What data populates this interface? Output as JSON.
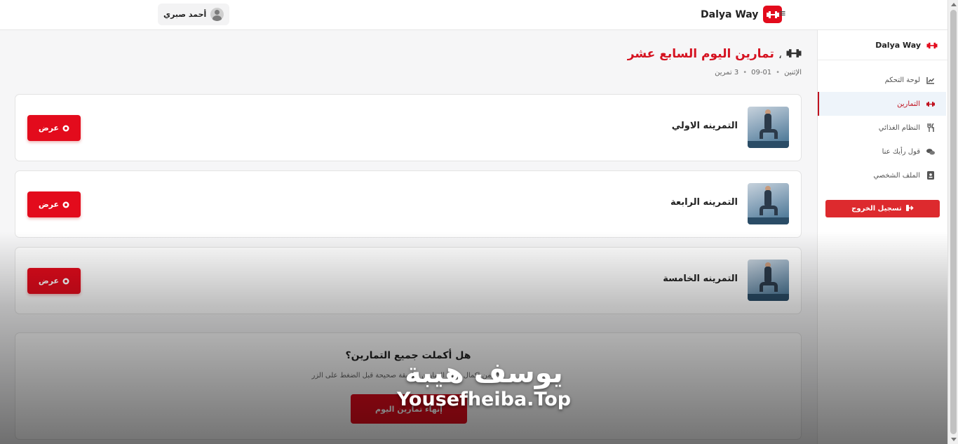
{
  "colors": {
    "brand_red": "#e30b1c",
    "active_nav_bg": "#eef4fa",
    "page_bg": "#f6f6f7"
  },
  "header": {
    "user_name": "أحمد صبري",
    "brand": "Dalya Way",
    "menu_icon": "hamburger-icon"
  },
  "sidebar": {
    "brand": "Dalya Way",
    "items": [
      {
        "label": "لوحة التحكم",
        "icon": "chart-line-icon",
        "active": false
      },
      {
        "label": "التمارين",
        "icon": "dumbbell-icon",
        "active": true
      },
      {
        "label": "النظام الغذائي",
        "icon": "utensils-icon",
        "active": false
      },
      {
        "label": "قول رأيك عنا",
        "icon": "comments-icon",
        "active": false
      },
      {
        "label": "الملف الشخصي",
        "icon": "id-card-icon",
        "active": false
      }
    ],
    "logout_label": "تسجيل الخروج"
  },
  "main": {
    "title": "تمارين اليوم السابع عشر",
    "title_separator": "،",
    "meta": {
      "day": "الإثنين",
      "date": "09-01",
      "count": "3 تمرين"
    },
    "workouts": [
      {
        "title": "التمرينه الاولي",
        "button": "عرض"
      },
      {
        "title": "التمرينه الرابعة",
        "button": "عرض"
      },
      {
        "title": "التمرينه الخامسة",
        "button": "عرض"
      }
    ],
    "complete": {
      "question": "هل أكملت جميع التمارين؟",
      "hint": "تأكد من إكمال جميع التمارين بطريقة صحيحة قبل الضغط على الزر",
      "button": "إنهاء تمارين اليوم"
    }
  },
  "watermark": {
    "arabic": "يوسف هيبة",
    "english": "Yousefheiba.Top"
  }
}
